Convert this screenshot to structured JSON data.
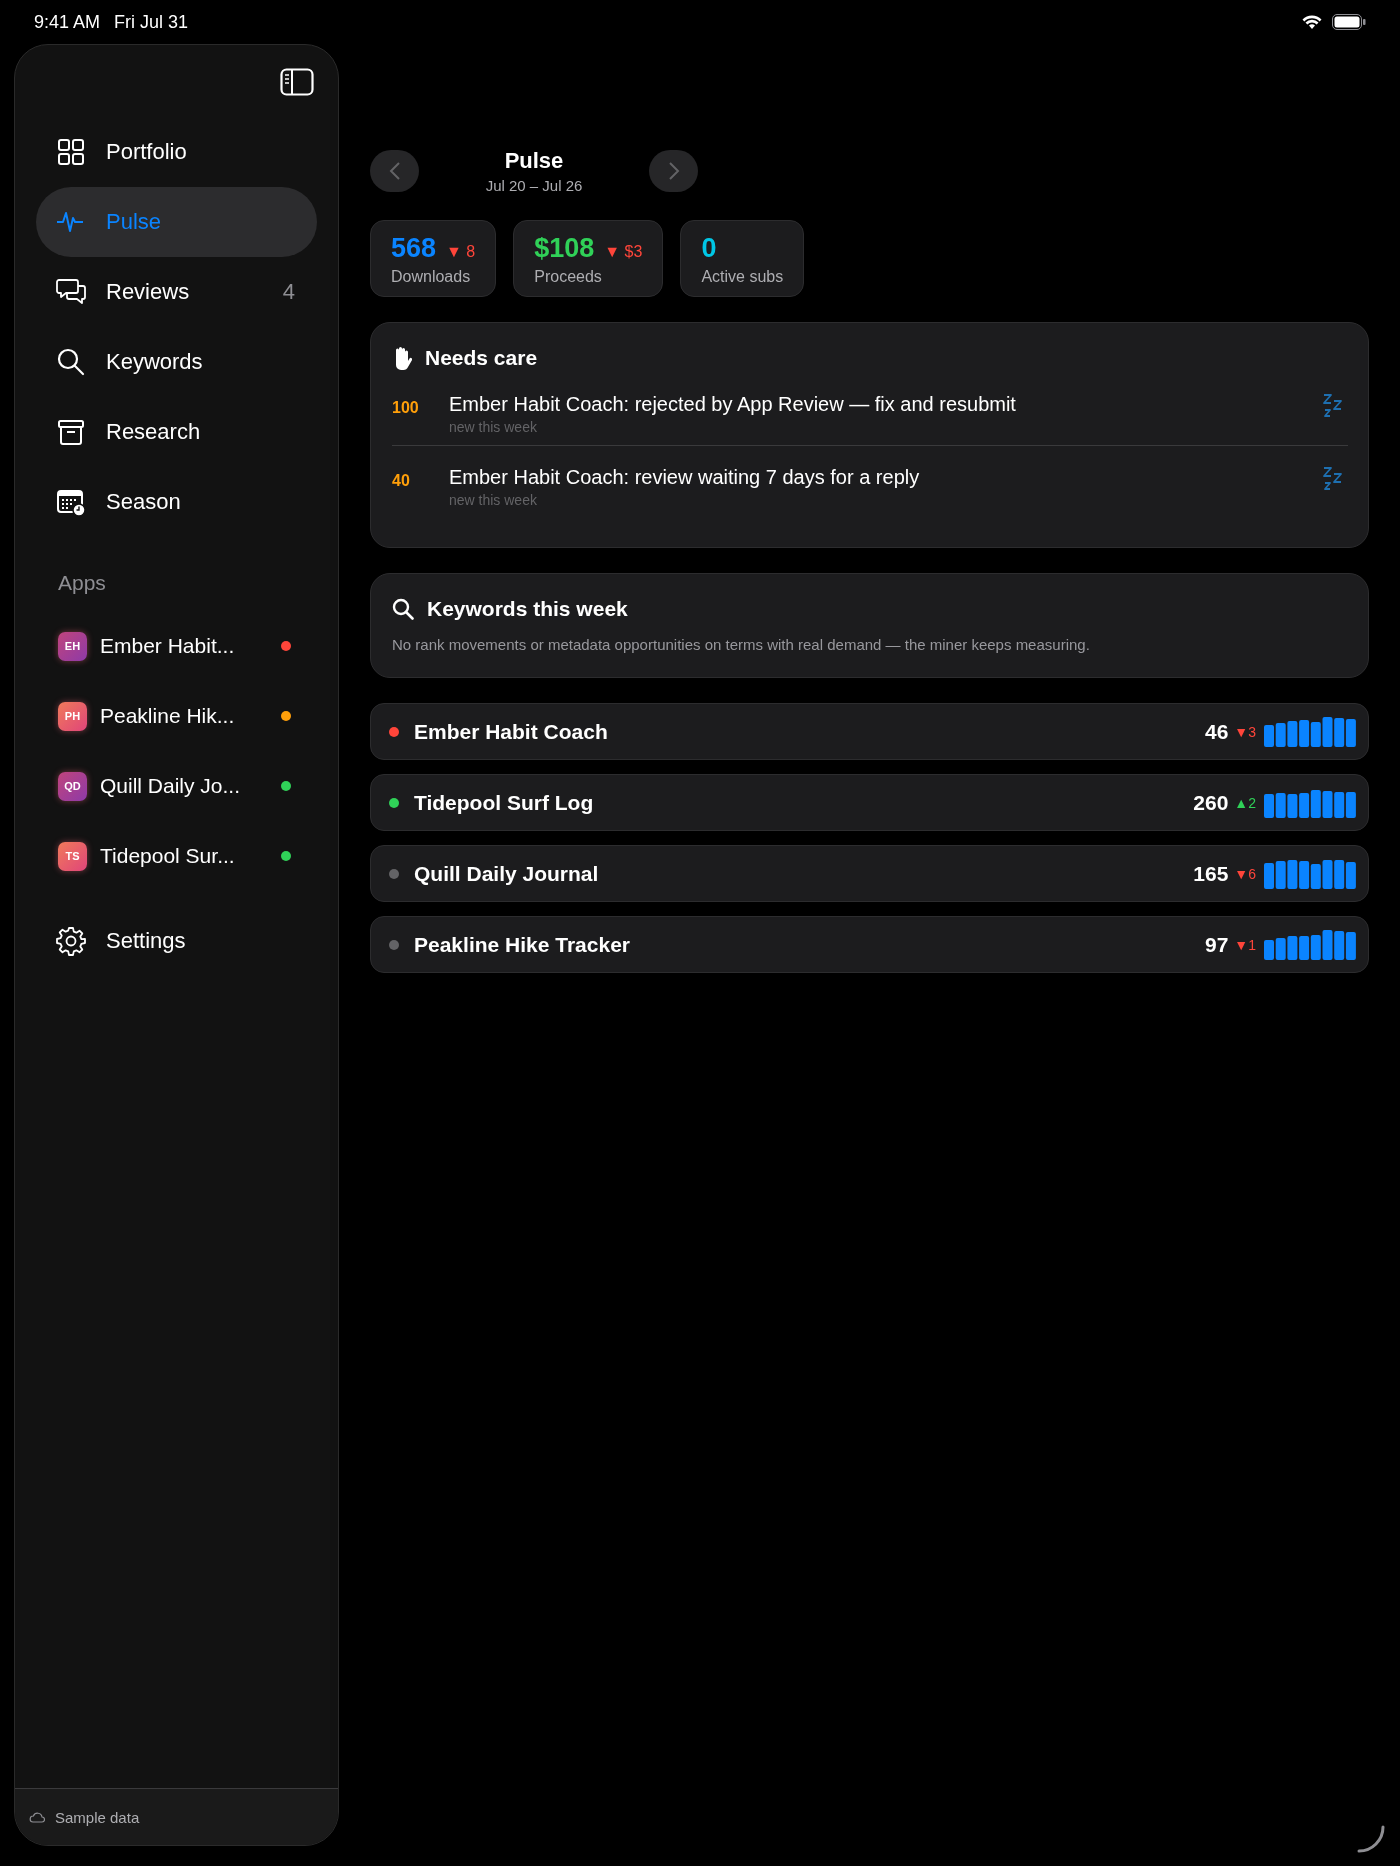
{
  "status_bar": {
    "time": "9:41 AM",
    "date": "Fri Jul 31"
  },
  "sidebar": {
    "items": [
      {
        "label": "Portfolio",
        "selected": false
      },
      {
        "label": "Pulse",
        "selected": true
      },
      {
        "label": "Reviews",
        "selected": false,
        "badge": "4"
      },
      {
        "label": "Keywords",
        "selected": false
      },
      {
        "label": "Research",
        "selected": false
      },
      {
        "label": "Season",
        "selected": false
      }
    ],
    "apps_header": "Apps",
    "apps": [
      {
        "initials": "EH",
        "name": "Ember Habit...",
        "color": "#ff453a"
      },
      {
        "initials": "PH",
        "name": "Peakline Hik...",
        "color": "#ff9f0a"
      },
      {
        "initials": "QD",
        "name": "Quill Daily Jo...",
        "color": "#30d158"
      },
      {
        "initials": "TS",
        "name": "Tidepool Sur...",
        "color": "#30d158"
      }
    ],
    "settings": "Settings",
    "footer": "Sample data"
  },
  "header": {
    "title": "Pulse",
    "subtitle": "Jul 20 – Jul 26"
  },
  "stats": [
    {
      "value": "568",
      "label": "Downloads",
      "color": "#0a84ff",
      "delta": {
        "text": "▼ 8",
        "color": "#ff453a"
      }
    },
    {
      "value": "$108",
      "label": "Proceeds",
      "color": "#30d158",
      "delta": {
        "text": "▼ $3",
        "color": "#ff453a"
      }
    },
    {
      "value": "0",
      "label": "Active subs",
      "color": "#00c7e6"
    }
  ],
  "needs_care": {
    "title": "Needs care",
    "items": [
      {
        "score": "100",
        "text": "Ember Habit Coach: rejected by App Review — fix and resubmit",
        "note": "new this week"
      },
      {
        "score": "40",
        "text": "Ember Habit Coach: review waiting 7 days for a reply",
        "note": "new this week"
      }
    ]
  },
  "keywords": {
    "title": "Keywords this week",
    "text": "No rank movements or metadata opportunities on terms with real demand — the miner keeps measuring."
  },
  "app_rows": [
    {
      "name": "Ember Habit Coach",
      "color": "#ff453a",
      "value": "46",
      "delta": {
        "text": "▼3",
        "color": "#ff453a"
      }
    },
    {
      "name": "Tidepool Surf Log",
      "color": "#30d158",
      "value": "260",
      "delta": {
        "text": "▲2",
        "color": "#30d158"
      }
    },
    {
      "name": "Quill Daily Journal",
      "color": "#636366",
      "value": "165",
      "delta": {
        "text": "▼6",
        "color": "#ff453a"
      }
    },
    {
      "name": "Peakline Hike Tracker",
      "color": "#636366",
      "value": "97",
      "delta": {
        "text": "▼1",
        "color": "#ff453a"
      }
    }
  ]
}
